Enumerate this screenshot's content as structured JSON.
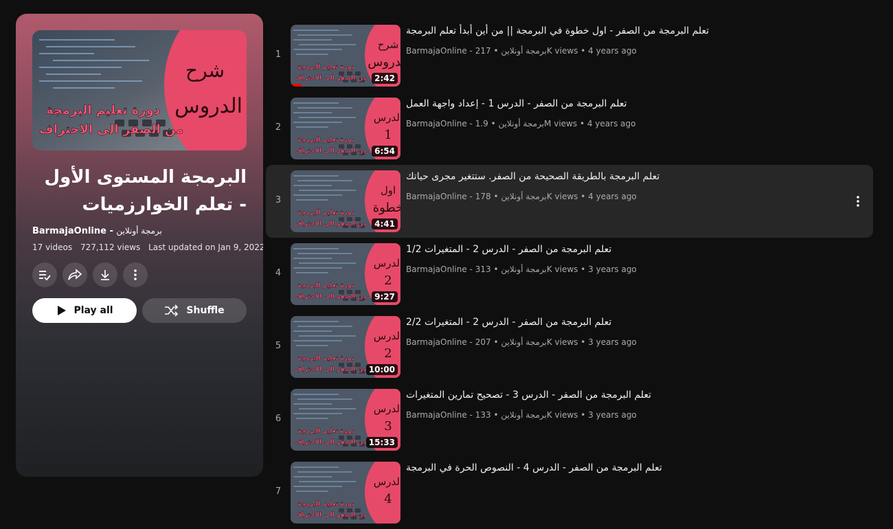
{
  "playlist": {
    "title": "البرمجة المستوى الأول - تعلم الخوارزميات",
    "owner": "BarmajaOnline",
    "owner_separator": " - ",
    "owner_arabic": "برمجة أونلاين",
    "video_count": "17 videos",
    "views": "727,112 views",
    "updated": "Last updated on Jan 9, 2022",
    "hero": {
      "badge_line1": "شرح",
      "badge_line2": "الدروس",
      "course_line1": "دورة تعليم البرمجة",
      "course_line2": "من الصفر الى الاحتراف"
    },
    "actions": {
      "play_all": "Play all",
      "shuffle": "Shuffle"
    }
  },
  "videos": [
    {
      "index": "1",
      "title": "تعلم البرمجة من الصفر - اول خطوة في البرمجة || من أين أبدأ تعلم البرمجة",
      "channel": "BarmajaOnline - برمجة أونلاين",
      "views": "217K views",
      "age": "4 years ago",
      "duration": "2:42",
      "badge1": "شرح",
      "badge2": "الدروس"
    },
    {
      "index": "2",
      "title": "تعلم البرمجة من الصفر - الدرس 1 - إعداد واجهة العمل",
      "channel": "BarmajaOnline - برمجة أونلاين",
      "views": "1.9M views",
      "age": "4 years ago",
      "duration": "6:54",
      "badge1": "الدرس",
      "badge2": "1"
    },
    {
      "index": "3",
      "title": "تعلم البرمجة بالطريقة الصحيحة من الصفر. ستتغير مجرى حياتك",
      "channel": "BarmajaOnline - برمجة أونلاين",
      "views": "178K views",
      "age": "4 years ago",
      "duration": "4:41",
      "badge1": "اول",
      "badge2": "خطوة"
    },
    {
      "index": "4",
      "title": "تعلم البرمجة من الصفر - الدرس 2 - المتغيرات 1/2",
      "channel": "BarmajaOnline - برمجة أونلاين",
      "views": "313K views",
      "age": "3 years ago",
      "duration": "9:27",
      "badge1": "الدرس",
      "badge2": "2"
    },
    {
      "index": "5",
      "title": "تعلم البرمجة من الصفر - الدرس 2 - المتغيرات 2/2",
      "channel": "BarmajaOnline - برمجة أونلاين",
      "views": "207K views",
      "age": "3 years ago",
      "duration": "10:00",
      "badge1": "الدرس",
      "badge2": "2"
    },
    {
      "index": "6",
      "title": "تعلم البرمجة من الصفر - الدرس 3 - تصحيح تمارين المتغيرات",
      "channel": "BarmajaOnline - برمجة أونلاين",
      "views": "133K views",
      "age": "3 years ago",
      "duration": "15:33",
      "badge1": "الدرس",
      "badge2": "3"
    },
    {
      "index": "7",
      "title": "تعلم البرمجة من الصفر - الدرس 4 - النصوص الحرة في البرمجة",
      "channel": "",
      "views": "",
      "age": "",
      "duration": "",
      "badge1": "الدرس",
      "badge2": "4"
    }
  ],
  "thumb_text": {
    "course_line1": "دورة تعليم البرمجة",
    "course_line2": "من الصفر الى الاحتراف"
  },
  "meta_separator": "•",
  "colors": {
    "background": "#0f0f0f",
    "hover_row": "#272727",
    "thumb_pink": "#e64a68",
    "progress": "#ff0000"
  }
}
